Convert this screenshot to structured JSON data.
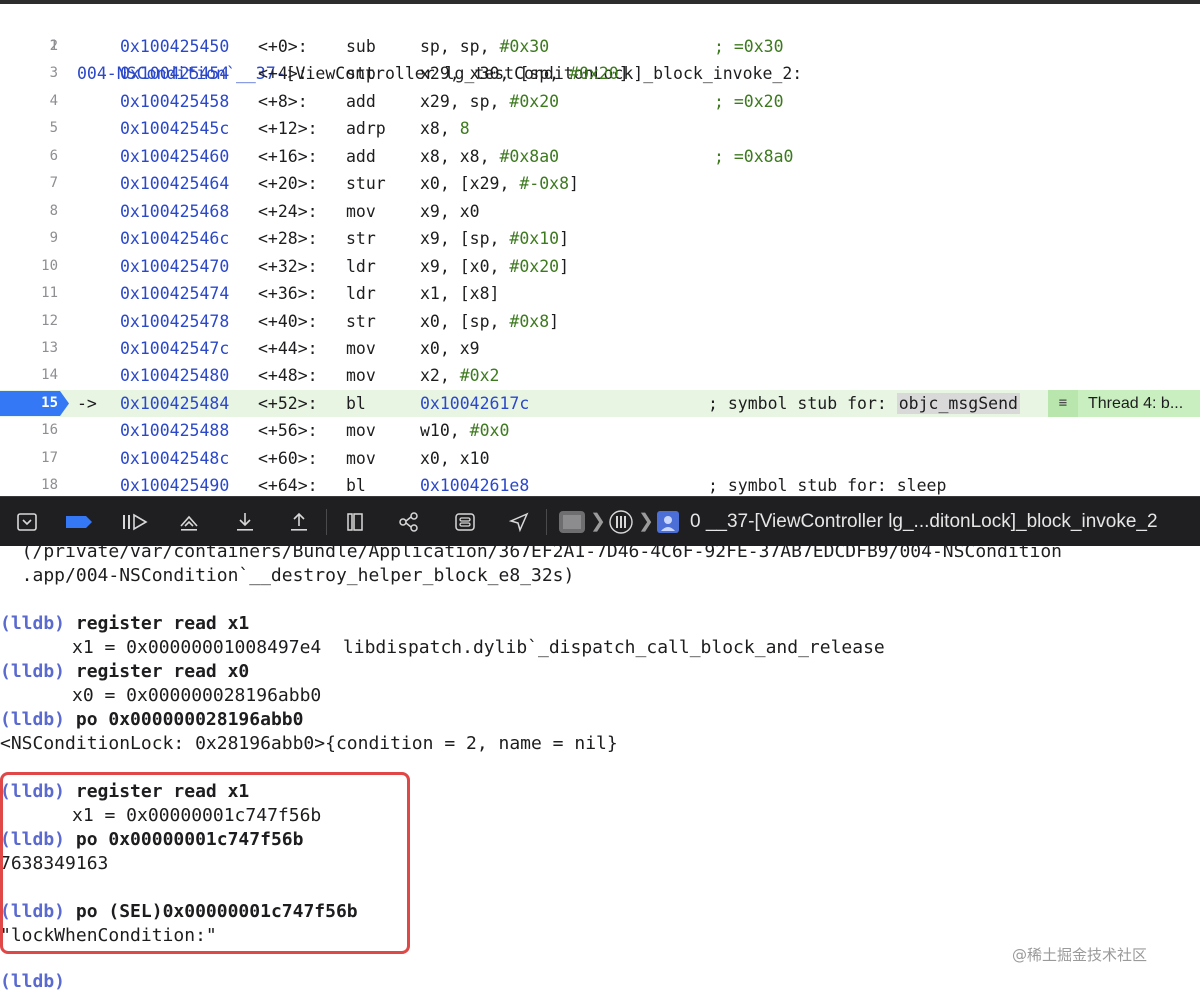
{
  "disassembly": {
    "title_prefix": "004-NSCondition`__37-",
    "title_method": "[ViewController lg_testConditonLock]",
    "title_suffix": "_block_invoke_2:",
    "current_line": "15",
    "pc_arrow": "->",
    "rows": [
      {
        "ln": "2",
        "addr": "0x100425450",
        "off": "<+0>:",
        "mn": "sub",
        "ops_a": "sp, sp, ",
        "imm": "#0x30",
        "comment": "; =0x30"
      },
      {
        "ln": "3",
        "addr": "0x100425454",
        "off": "<+4>:",
        "mn": "stp",
        "ops_a": "x29, x30, [sp, ",
        "imm": "#0x20",
        "ops_b": "]",
        "comment": ""
      },
      {
        "ln": "4",
        "addr": "0x100425458",
        "off": "<+8>:",
        "mn": "add",
        "ops_a": "x29, sp, ",
        "imm": "#0x20",
        "comment": "; =0x20"
      },
      {
        "ln": "5",
        "addr": "0x10042545c",
        "off": "<+12>:",
        "mn": "adrp",
        "ops_a": "x8, ",
        "num": "8",
        "comment": ""
      },
      {
        "ln": "6",
        "addr": "0x100425460",
        "off": "<+16>:",
        "mn": "add",
        "ops_a": "x8, x8, ",
        "imm": "#0x8a0",
        "comment": "; =0x8a0"
      },
      {
        "ln": "7",
        "addr": "0x100425464",
        "off": "<+20>:",
        "mn": "stur",
        "ops_a": "x0, [x29, ",
        "imm": "#-0x8",
        "ops_b": "]",
        "comment": ""
      },
      {
        "ln": "8",
        "addr": "0x100425468",
        "off": "<+24>:",
        "mn": "mov",
        "ops_a": "x9, x0",
        "comment": ""
      },
      {
        "ln": "9",
        "addr": "0x10042546c",
        "off": "<+28>:",
        "mn": "str",
        "ops_a": "x9, [sp, ",
        "imm": "#0x10",
        "ops_b": "]",
        "comment": ""
      },
      {
        "ln": "10",
        "addr": "0x100425470",
        "off": "<+32>:",
        "mn": "ldr",
        "ops_a": "x9, [x0, ",
        "imm": "#0x20",
        "ops_b": "]",
        "comment": ""
      },
      {
        "ln": "11",
        "addr": "0x100425474",
        "off": "<+36>:",
        "mn": "ldr",
        "ops_a": "x1, [x8]",
        "comment": ""
      },
      {
        "ln": "12",
        "addr": "0x100425478",
        "off": "<+40>:",
        "mn": "str",
        "ops_a": "x0, [sp, ",
        "imm": "#0x8",
        "ops_b": "]",
        "comment": ""
      },
      {
        "ln": "13",
        "addr": "0x10042547c",
        "off": "<+44>:",
        "mn": "mov",
        "ops_a": "x0, x9",
        "comment": ""
      },
      {
        "ln": "14",
        "addr": "0x100425480",
        "off": "<+48>:",
        "mn": "mov",
        "ops_a": "x2, ",
        "imm": "#0x2",
        "comment": ""
      },
      {
        "ln": "15",
        "addr": "0x100425484",
        "off": "<+52>:",
        "mn": "bl",
        "hex": "0x10042617c",
        "sym_prefix": "; symbol stub for: ",
        "sym": "objc_msgSend"
      },
      {
        "ln": "16",
        "addr": "0x100425488",
        "off": "<+56>:",
        "mn": "mov",
        "ops_a": "w10, ",
        "imm": "#0x0",
        "comment": ""
      },
      {
        "ln": "17",
        "addr": "0x10042548c",
        "off": "<+60>:",
        "mn": "mov",
        "ops_a": "x0, x10",
        "comment": ""
      },
      {
        "ln": "18",
        "addr": "0x100425490",
        "off": "<+64>:",
        "mn": "bl",
        "hex": "0x1004261e8",
        "sym_prefix": "; symbol stub for: sleep",
        "sym": ""
      }
    ],
    "thread_badge": "Thread 4: b..."
  },
  "toolbar": {
    "breadcrumb_frame": "0 __37-[ViewController lg_...ditonLock]_block_invoke_2",
    "icons": [
      "hide-debug-area-icon",
      "breakpoints-toggle-icon",
      "continue-icon",
      "step-over-icon",
      "step-into-icon",
      "step-out-icon",
      "debug-view-hierarchy-icon",
      "memory-graph-icon",
      "environment-overrides-icon",
      "simulate-location-icon",
      "process-icon",
      "thread-icon",
      "frame-icon"
    ]
  },
  "console": {
    "prompt": "(lldb)",
    "path_line_1": "  (/private/var/containers/Bundle/Application/367EF2A1-7D46-4C6F-92FE-37AB7EDCDFB9/004-NSCondition",
    "path_line_2": "  .app/004-NSCondition`__destroy_helper_block_e8_32s)",
    "cmd1": "register read x1",
    "out1": "x1 = 0x00000001008497e4  libdispatch.dylib`_dispatch_call_block_and_release",
    "cmd2": "register read x0",
    "out2": "x0 = 0x000000028196abb0",
    "cmd3": "po 0x000000028196abb0",
    "out3": "<NSConditionLock: 0x28196abb0>{condition = 2, name = nil}",
    "cmd4": "register read x1",
    "out4": "x1 = 0x00000001c747f56b",
    "cmd5": "po 0x00000001c747f56b",
    "out5": "7638349163",
    "cmd6": "po (SEL)0x00000001c747f56b",
    "out6": "\"lockWhenCondition:\"",
    "watermark": "@稀土掘金技术社区"
  }
}
